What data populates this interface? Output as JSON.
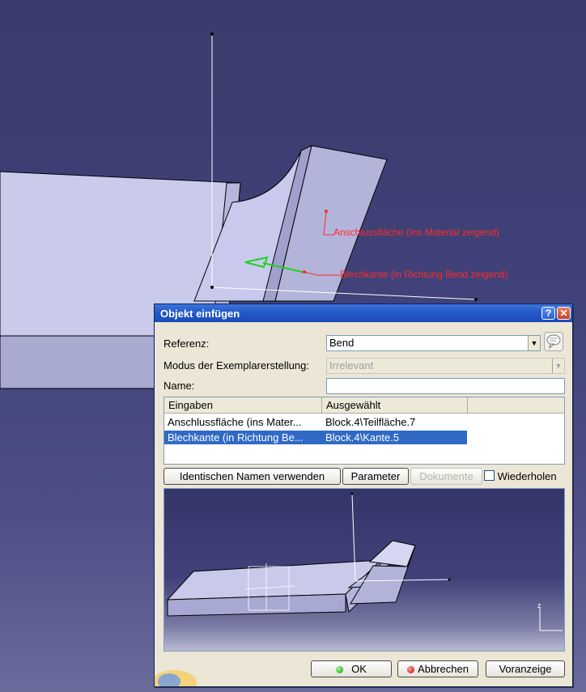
{
  "annotations": {
    "anschluss": "Anschlussfläche (ins Material zeigend)",
    "blechkante": "Blechkante (in Richtung Bend zeigend)"
  },
  "dialog": {
    "title": "Objekt einfügen",
    "help_symbol": "?",
    "close_symbol": "✕",
    "referenz_label": "Referenz:",
    "referenz_value": "Bend",
    "modus_label": "Modus der Exemplarerstellung:",
    "modus_value": "Irrelevant",
    "name_label": "Name:",
    "name_value": "",
    "table": {
      "columns": [
        "Eingaben",
        "Ausgewählt"
      ],
      "rows": [
        {
          "eingabe": "Anschlussfläche (ins Mater...",
          "ausgewaehlt": "Block.4\\Teilfläche.7"
        },
        {
          "eingabe": "Blechkante (in Richtung Be...",
          "ausgewaehlt": "Block.4\\Kante.5"
        }
      ]
    },
    "buttons": {
      "identisch": "Identischen Namen verwenden",
      "parameter": "Parameter",
      "dokumente": "Dokumente",
      "wiederholen": "Wiederholen",
      "ok": "OK",
      "abbrechen": "Abbrechen",
      "voranzeige": "Voranzeige"
    },
    "preview_axis_z": "z"
  },
  "colors": {
    "viewport_bg": "#3f417a",
    "part_face": "#c7c7ea",
    "annotation": "#ff2a2a",
    "selection": "#316ac5",
    "titlebar": "#2459c9"
  }
}
